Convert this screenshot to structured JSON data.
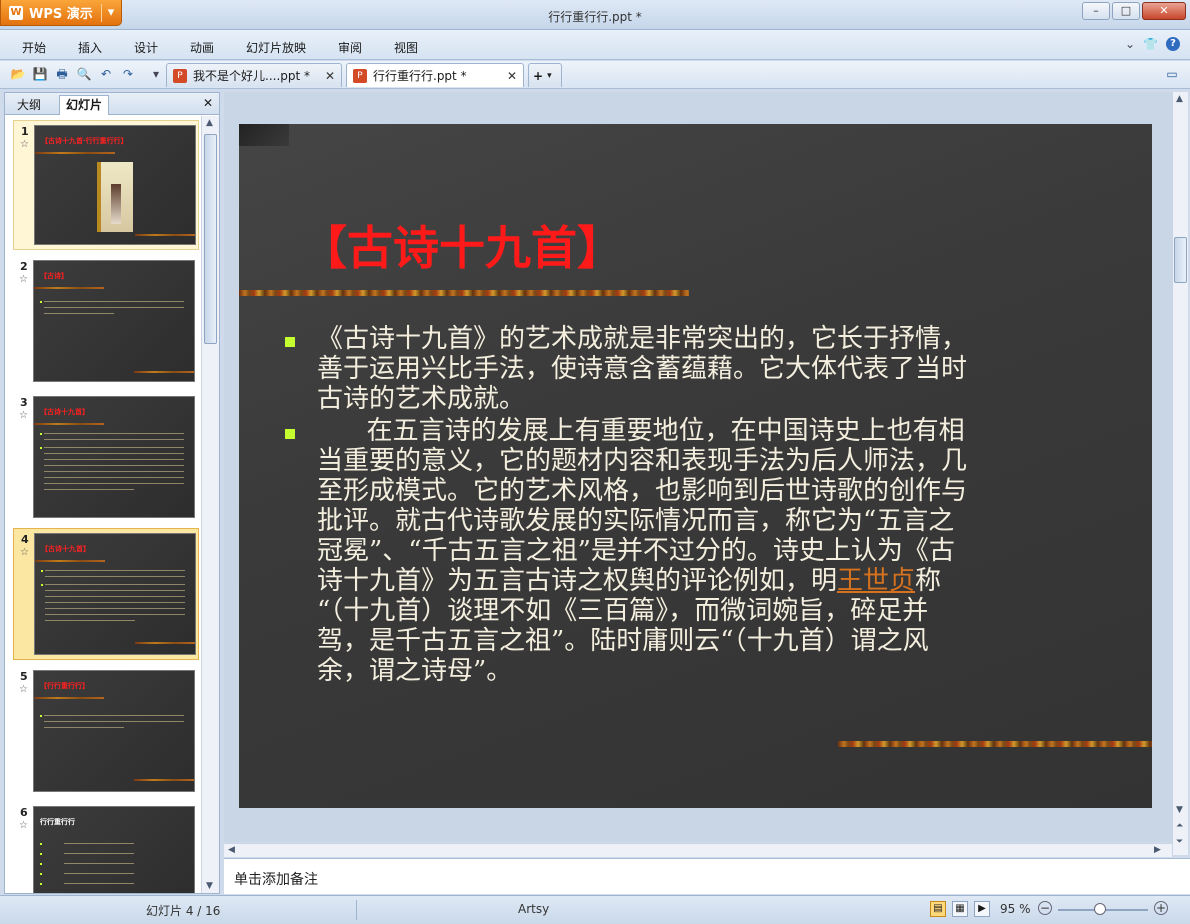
{
  "app": {
    "name": "WPS 演示",
    "window_title": "行行重行行.ppt *"
  },
  "colors": {
    "accent": "#e4720d",
    "slide_bg": "#3f3f3f",
    "title_red": "#ff1a1a",
    "bullet_green": "#c6ff2f",
    "link": "#d6721e"
  },
  "window_buttons": {
    "minimize": "–",
    "maximize": "□",
    "close": "✕"
  },
  "menu": {
    "items": [
      "开始",
      "插入",
      "设计",
      "动画",
      "幻灯片放映",
      "审阅",
      "视图"
    ],
    "right_icons": [
      "chevron-down-icon",
      "shirt-icon",
      "help-icon"
    ],
    "right": [
      "⌄",
      "👕",
      "?"
    ]
  },
  "toolbar": {
    "icons": [
      "open-icon",
      "save-icon",
      "print-icon",
      "print-preview-icon",
      "undo-icon",
      "redo-icon",
      "more-icon"
    ],
    "glyphs": [
      "📂",
      "💾",
      "🖶",
      "🔍",
      "↶",
      "↷",
      "▾"
    ]
  },
  "doc_tabs": [
    {
      "label": "我不是个好儿....ppt *",
      "close": "✕"
    },
    {
      "label": "行行重行行.ppt *",
      "close": "✕"
    }
  ],
  "new_tab": "+",
  "panel": {
    "tabs": [
      "大纲",
      "幻灯片"
    ],
    "close": "✕"
  },
  "thumbnails": [
    {
      "num": "1",
      "title": "【古诗十九首·行行重行行】",
      "star": "☆"
    },
    {
      "num": "2",
      "title": "【古诗】",
      "star": "☆"
    },
    {
      "num": "3",
      "title": "【古诗十九首】",
      "star": "☆"
    },
    {
      "num": "4",
      "title": "【古诗十九首】",
      "star": "☆"
    },
    {
      "num": "5",
      "title": "【行行重行行】",
      "star": "☆"
    },
    {
      "num": "6",
      "title": "行行重行行",
      "star": "☆"
    }
  ],
  "slide": {
    "title": "【古诗十九首】",
    "para1": "《古诗十九首》的艺术成就是非常突出的，它长于抒情，\n善于运用兴比手法，使诗意含蓄蕴藉。它大体代表了当时\n古诗的艺术成就。",
    "para2a": "      在五言诗的发展上有重要地位，在中国诗史上也有相\n当重要的意义，它的题材内容和表现手法为后人师法，几\n至形成模式。它的艺术风格，也影响到后世诗歌的创作与\n批评。就古代诗歌发展的实际情况而言，称它为“五言之\n冠冕”、“千古五言之祖”是并不过分的。诗史上认为《古\n诗十九首》为五言古诗之权舆的评论例如，明",
    "para2_link": "王世贞",
    "para2b": "称\n“（十九首）谈理不如《三百篇》，而微词婉旨，碎足并\n驾，是千古五言之祖”。陆时庸则云“（十九首）谓之风\n余，谓之诗母”。"
  },
  "notes": {
    "placeholder": "单击添加备注"
  },
  "status": {
    "slide_counter": "幻灯片 4 / 16",
    "theme": "Artsy",
    "zoom": "95 %",
    "zoom_level": 0.5,
    "zoom_minus": "−",
    "zoom_plus": "+"
  }
}
